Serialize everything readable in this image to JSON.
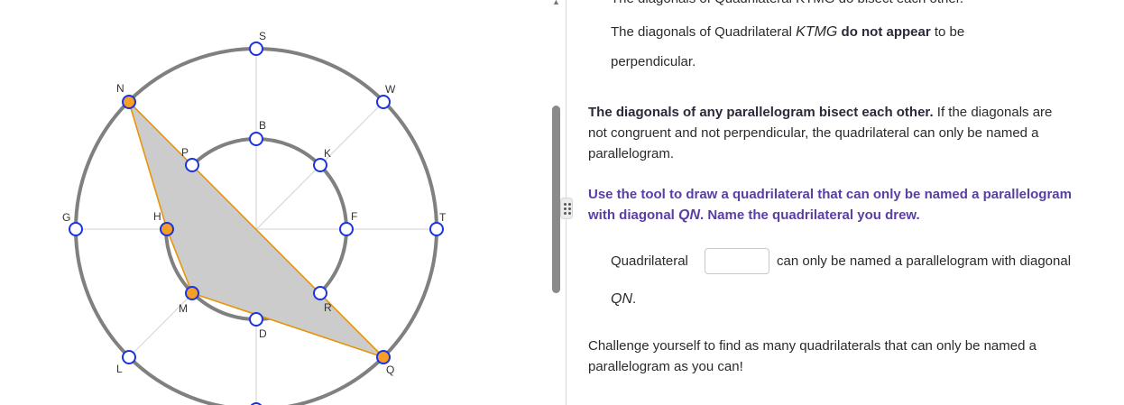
{
  "diagram": {
    "points": {
      "G": "G",
      "T": "T",
      "S": "S",
      "W": "W",
      "N": "N",
      "L": "L",
      "Q": "Q",
      "B": "B",
      "K": "K",
      "F": "F",
      "R": "R",
      "D": "D",
      "M": "M",
      "H": "H",
      "P": "P"
    },
    "polygon_fill": "#cccccc",
    "polygon_stroke": "#e8940a",
    "selected_point_color": "#f5a024",
    "empty_point_stroke": "#1a33e0"
  },
  "text": {
    "cut_line": "The diagonals of Quadrilateral KTMG do bisect each other.",
    "para1_a": "The diagonals of Quadrilateral",
    "para1_name": "KTMG",
    "para1_bold": "do not appear",
    "para1_b": "to be",
    "para1_c": "perpendicular.",
    "para2_bold": "The diagonals of any parallelogram bisect each other.",
    "para2_a": "If the diagonals are",
    "para2_b": "not congruent and not perpendicular, the quadrilateral can only be named a",
    "para2_c": "parallelogram.",
    "prompt_a": "Use the tool to draw a quadrilateral that can only be named a parallelogram",
    "prompt_b": "with diagonal",
    "prompt_diag": "QN",
    "prompt_c": ". Name the quadrilateral you drew.",
    "answer_label": "Quadrilateral",
    "answer_after": "can only be named a parallelogram with diagonal",
    "answer_diag": "QN",
    "answer_end": ".",
    "challenge_a": "Challenge yourself to find as many quadrilaterals that can only be named a",
    "challenge_b": "parallelogram as you can!"
  },
  "answer": {
    "value": "",
    "placeholder": ""
  }
}
